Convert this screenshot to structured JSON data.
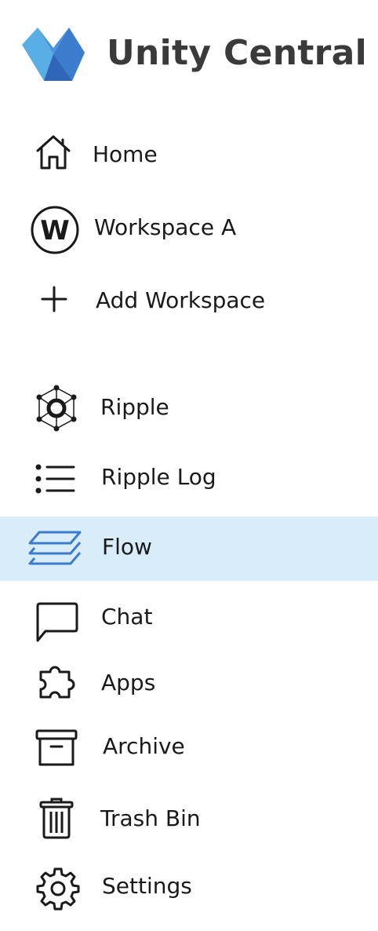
{
  "brand": {
    "title": "Unity Central",
    "logo_icon": "unity-central-logo",
    "logo_colors": [
      "#5aaee6",
      "#3c7ccd",
      "#2f66b8"
    ]
  },
  "colors": {
    "active_background": "#d8ecfa",
    "active_icon": "#3c7ccd",
    "text": "#1a1a1a"
  },
  "nav": {
    "items": [
      {
        "label": "Home",
        "icon": "home-icon"
      },
      {
        "label": "Workspace A",
        "icon": "workspace-a-icon",
        "badge": "W"
      },
      {
        "label": "Add Workspace",
        "icon": "plus-icon"
      },
      {
        "label": "Ripple",
        "icon": "ripple-icon"
      },
      {
        "label": "Ripple Log",
        "icon": "list-icon"
      },
      {
        "label": "Flow",
        "icon": "layers-icon",
        "active": true
      },
      {
        "label": "Chat",
        "icon": "chat-bubble-icon"
      },
      {
        "label": "Apps",
        "icon": "puzzle-icon"
      },
      {
        "label": "Archive",
        "icon": "archive-box-icon"
      },
      {
        "label": "Trash Bin",
        "icon": "trash-icon"
      },
      {
        "label": "Settings",
        "icon": "gear-icon"
      }
    ]
  }
}
